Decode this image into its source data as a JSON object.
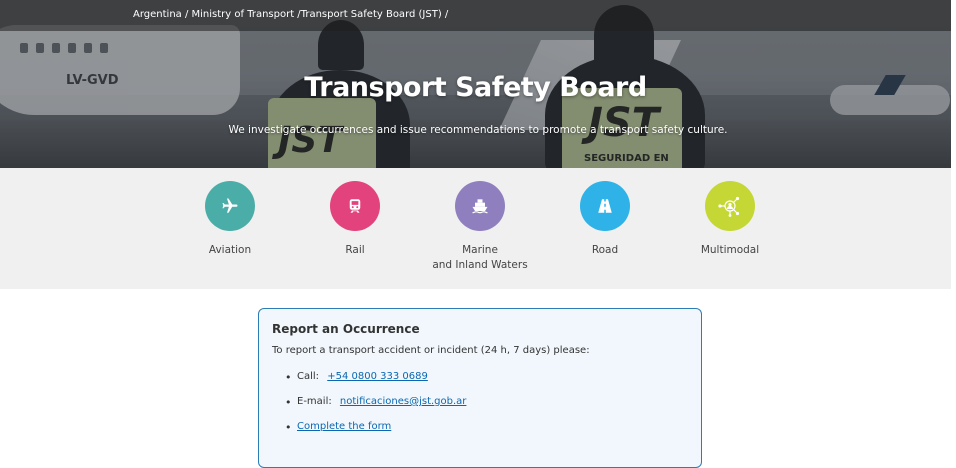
{
  "breadcrumb": {
    "items": [
      "Argentina",
      "Ministry of Transport",
      "Transport Safety Board (JST)"
    ],
    "separator": " / "
  },
  "hero": {
    "title": "Transport Safety Board",
    "subtitle": "We investigate occurrences and issue recommendations to promote a transport safety culture.",
    "photo_text": {
      "plane_registration": "LV-GVD",
      "vest_left": "JST",
      "vest_right": "JST",
      "vest_right_sub": "SEGURIDAD EN"
    }
  },
  "categories": [
    {
      "label": "Aviation",
      "color": "#4bada8",
      "icon": "airplane-icon"
    },
    {
      "label": "Rail",
      "color": "#e2437c",
      "icon": "train-icon"
    },
    {
      "label_line1": "Marine",
      "label_line2": "and Inland Waters",
      "color": "#8f7fbf",
      "icon": "ship-icon"
    },
    {
      "label": "Road",
      "color": "#2eb2e8",
      "icon": "road-icon"
    },
    {
      "label": "Multimodal",
      "color": "#c4d735",
      "icon": "network-icon"
    }
  ],
  "report": {
    "title": "Report an Occurrence",
    "intro": "To report a transport accident or incident (24 h, 7 days) please:",
    "items": [
      {
        "prefix": "Call:",
        "link": "+54 0800 333 0689"
      },
      {
        "prefix": "E-mail:",
        "link": "notificaciones@jst.gob.ar"
      },
      {
        "prefix": "",
        "link": "Complete the form"
      }
    ]
  },
  "colors": {
    "link": "#0b67b2",
    "report_border": "#2d7db5",
    "report_bg": "#f1f7fc",
    "category_bg": "#f0f0f0"
  }
}
